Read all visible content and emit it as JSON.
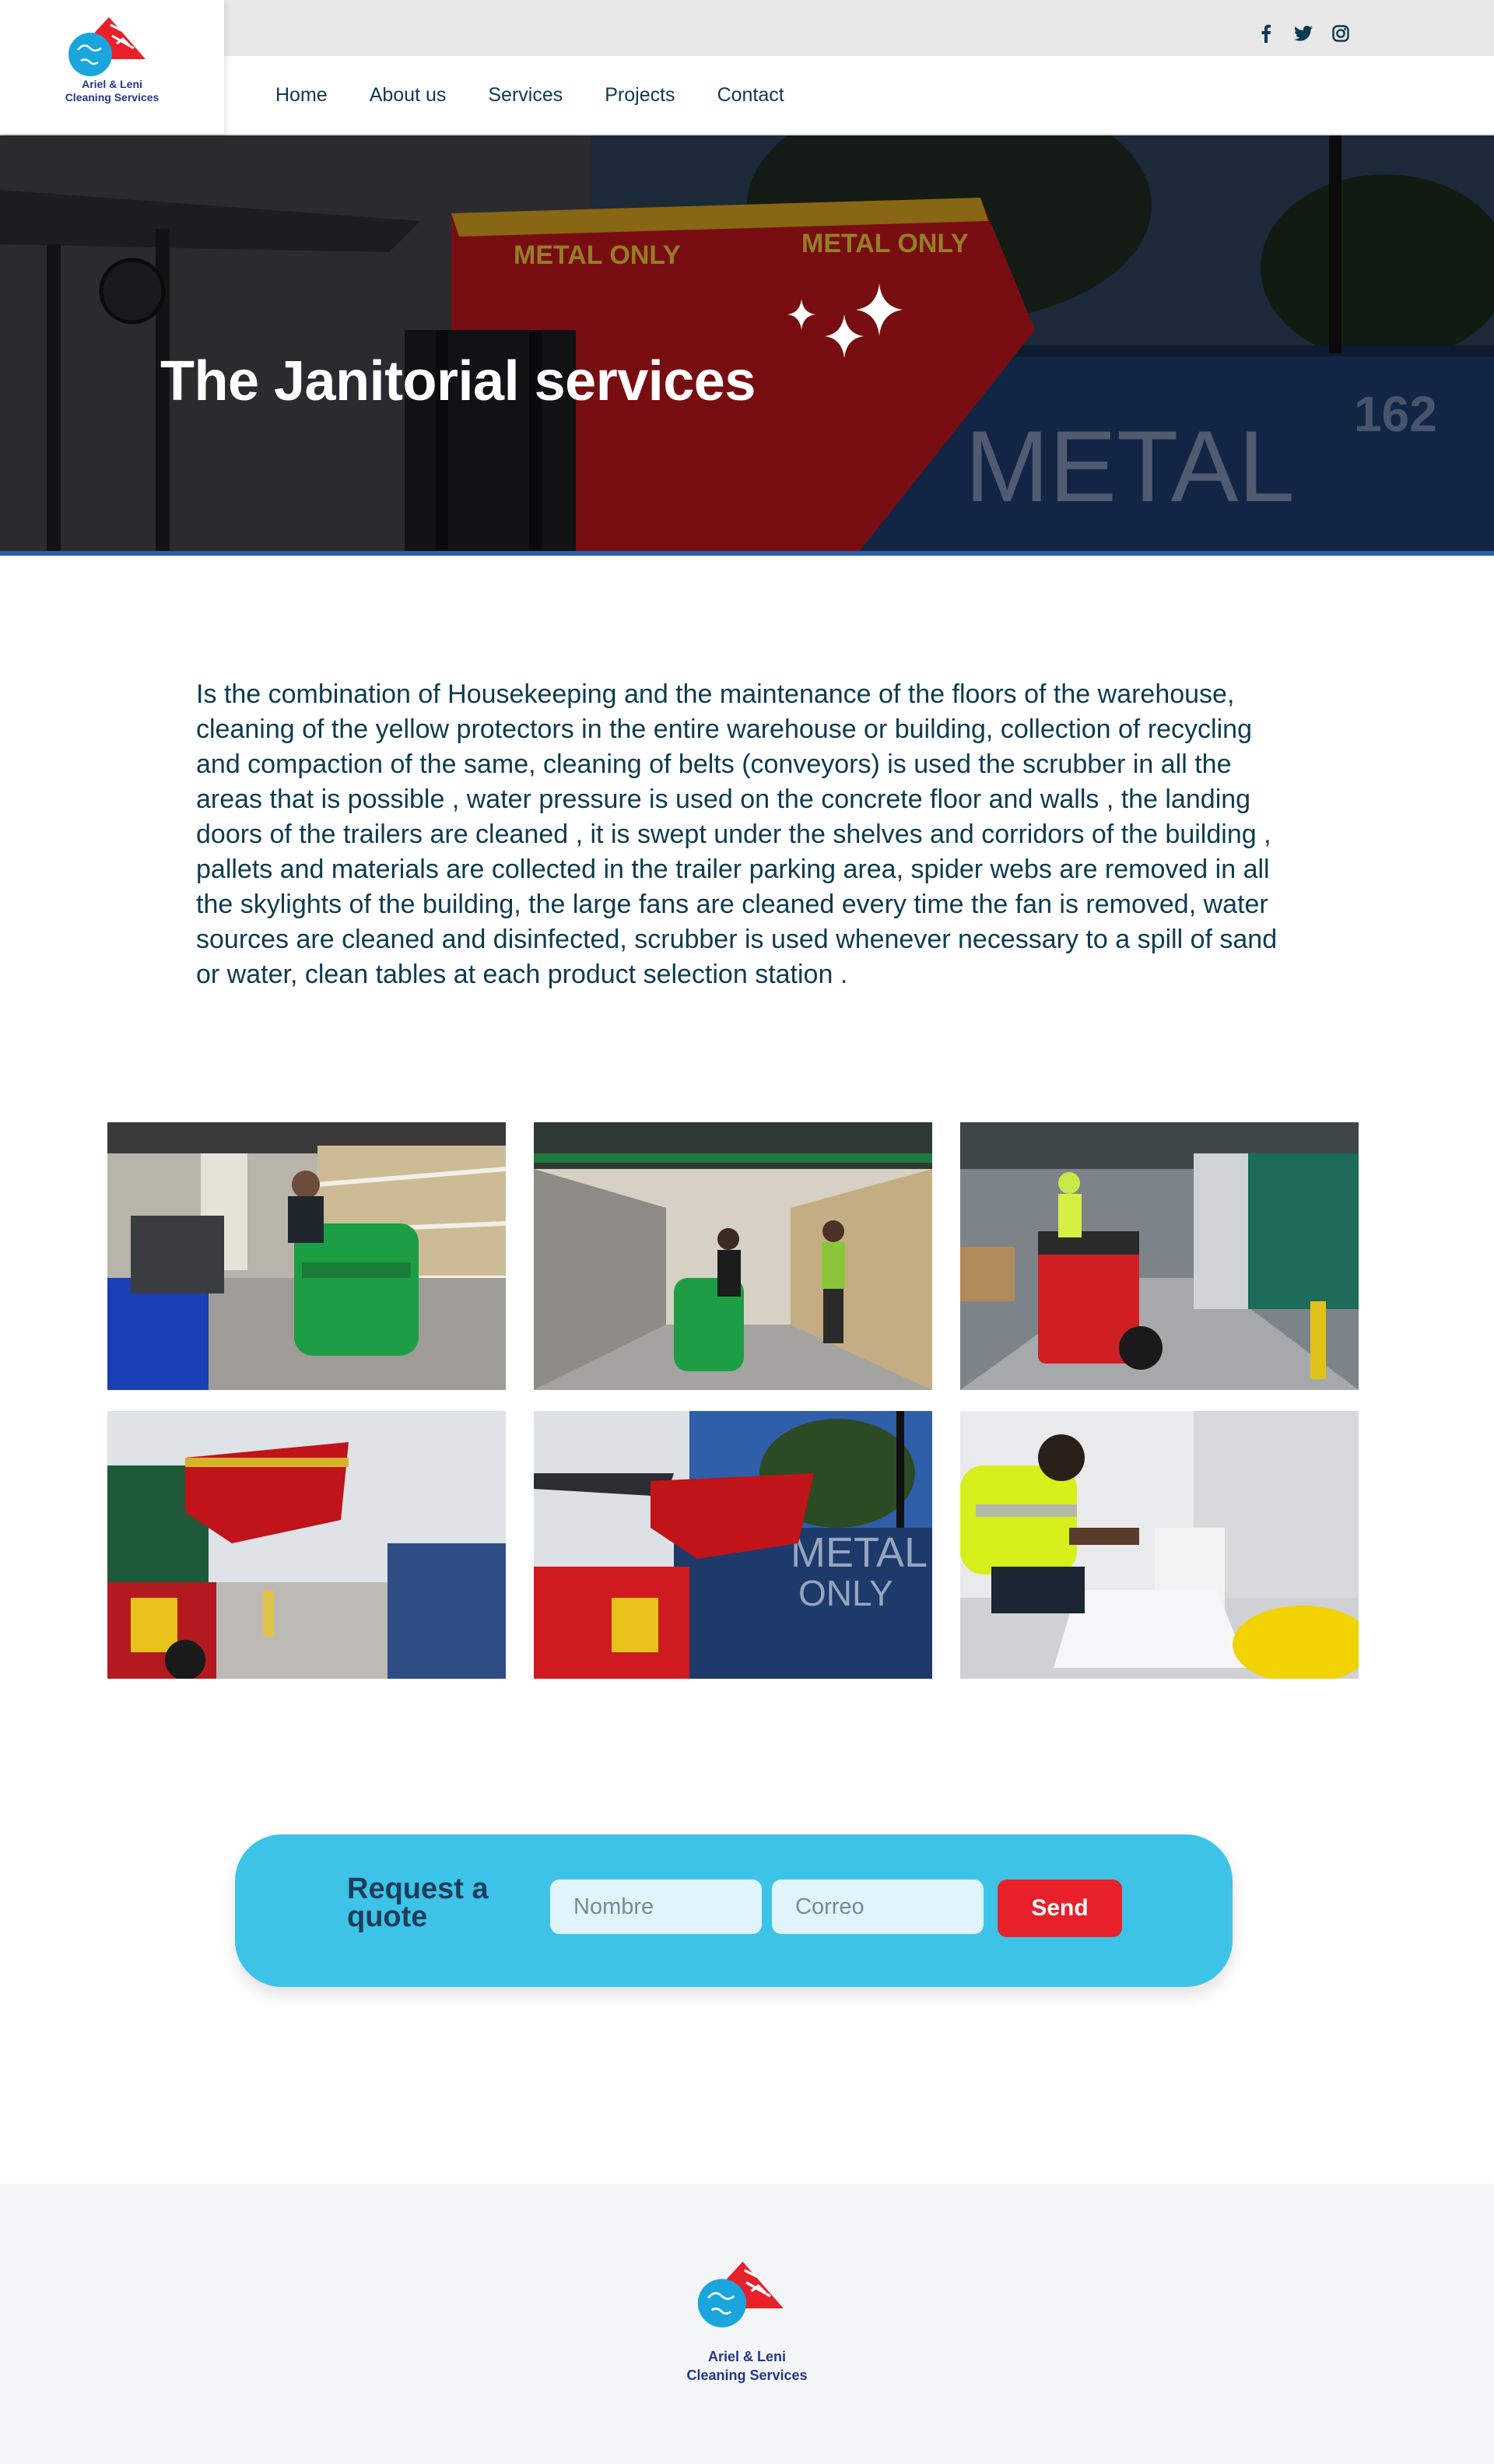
{
  "brand": {
    "line1": "Ariel & Leni",
    "line2": "Cleaning Services"
  },
  "social": [
    "facebook-icon",
    "twitter-icon",
    "instagram-icon"
  ],
  "nav": {
    "items": [
      "Home",
      "About us",
      "Services",
      "Projects",
      "Contact"
    ]
  },
  "hero": {
    "title": "The Janitorial services"
  },
  "description": "Is the combination of Housekeeping and the maintenance of the floors of the warehouse, cleaning of the yellow protectors in the entire warehouse or building, collection of recycling and compaction of the same, cleaning of belts (conveyors) is used the scrubber in all the areas that is possible , water pressure is used on the concrete floor and walls , the landing doors of the trailers are cleaned , it is swept under the shelves and corridors of the building , pallets and materials are collected in the trailer parking area, spider webs are removed in all the skylights of the building, the large fans are cleaned every time the fan is removed, water sources are cleaned and disinfected, scrubber is used whenever necessary to a spill of sand or water, clean tables at each product selection station .",
  "quote": {
    "title": "Request a quote",
    "name_placeholder": "Nombre",
    "email_placeholder": "Correo",
    "send_label": "Send"
  },
  "colors": {
    "accent_blue": "#3dc3e8",
    "accent_red": "#e8202a",
    "text_dark": "#0d3b4f",
    "footer_bg": "#f4f5f6"
  }
}
